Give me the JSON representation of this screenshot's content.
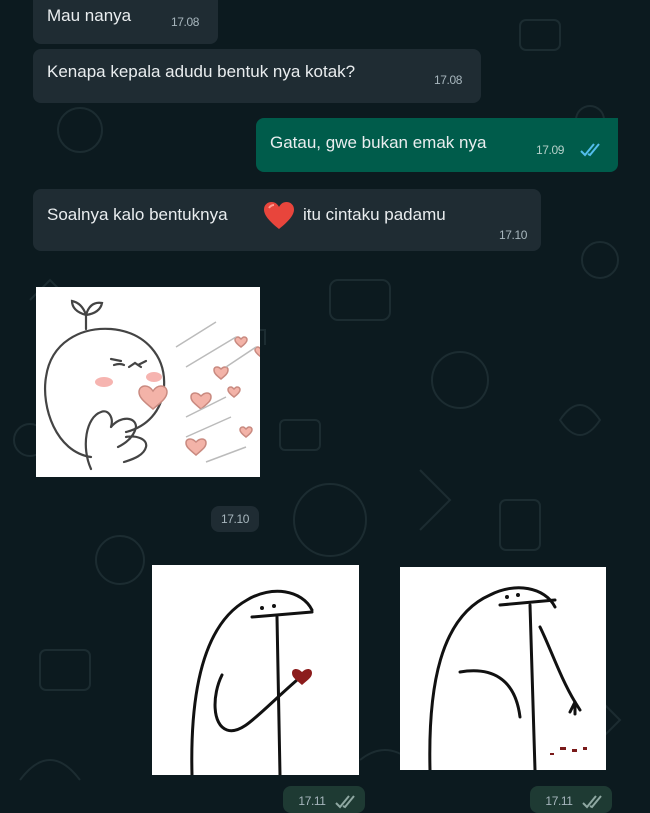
{
  "chat": {
    "messages": [
      {
        "direction": "incoming",
        "text": "Mau nanya",
        "time": "17.08"
      },
      {
        "direction": "incoming",
        "text": "Kenapa kepala adudu bentuk nya kotak?",
        "time": "17.08"
      },
      {
        "direction": "outgoing",
        "text": "Gatau, gwe bukan emak nya",
        "time": "17.09",
        "status": "read"
      },
      {
        "direction": "incoming",
        "text_before": "Soalnya kalo bentuknya",
        "emoji": "heart-emoji",
        "text_after": "itu cintaku padamu",
        "time": "17.10"
      }
    ],
    "stickers": [
      {
        "direction": "incoming",
        "icon": "cute-blush-hearts-sticker",
        "time": "17.10"
      },
      {
        "direction": "outgoing",
        "icon": "flork-holding-heart-sticker",
        "time": "17.11",
        "status": "read"
      },
      {
        "direction": "outgoing",
        "icon": "flork-dropping-heart-sticker",
        "time": "17.11",
        "status": "read"
      }
    ]
  },
  "colors": {
    "background": "#0c1a1f",
    "incoming_bubble": "#1f2c33",
    "outgoing_bubble": "#005c4b",
    "read_ticks": "#53bdeb",
    "heart": "#e8453c"
  }
}
